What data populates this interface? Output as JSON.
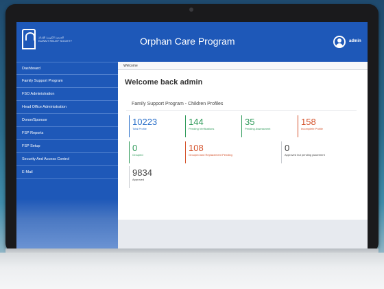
{
  "header": {
    "logo_text_line1": "الجمعية الكويتية للإغاثة",
    "logo_text_line2": "KUWAIT RELIEF SOCIETY",
    "app_title": "Orphan Care Program",
    "user_name": "admin"
  },
  "sidebar": {
    "items": [
      {
        "label": "Dashboard"
      },
      {
        "label": "Family Support Program"
      },
      {
        "label": "FSO Administration"
      },
      {
        "label": "Head Office Administration"
      },
      {
        "label": "Donor/Sponsor"
      },
      {
        "label": "FSP Reports"
      },
      {
        "label": "FSP Setup"
      },
      {
        "label": "Security And Access Control"
      },
      {
        "label": "E-Mail"
      }
    ]
  },
  "main": {
    "breadcrumb": "Welcome",
    "welcome": "Welcome back admin",
    "panel_title": "Family Support Program - Children Profiles",
    "tiles": [
      {
        "value": "10223",
        "label": "Total Profile",
        "color": "#2a6fc9"
      },
      {
        "value": "144",
        "label": "Pending Verifications",
        "color": "#2f9a5a"
      },
      {
        "value": "35",
        "label": "Pending Assessment",
        "color": "#2f9a5a"
      },
      {
        "value": "158",
        "label": "Incomplete Profile",
        "color": "#d4512a"
      },
      {
        "value": "0",
        "label": "Grouped",
        "color": "#2f9a5a"
      },
      {
        "value": "108",
        "label": "Grouped and Replacement Pending",
        "color": "#d4512a"
      },
      {
        "value": "0",
        "label": "Approved but pending placement",
        "color": "#444444"
      },
      {
        "value": "9834",
        "label": "Approved",
        "color": "#444444"
      }
    ]
  },
  "colors": {
    "brand_blue": "#1e58b8",
    "blue": "#2a6fc9",
    "green": "#2f9a5a",
    "orange": "#d4512a",
    "grey": "#444444"
  }
}
